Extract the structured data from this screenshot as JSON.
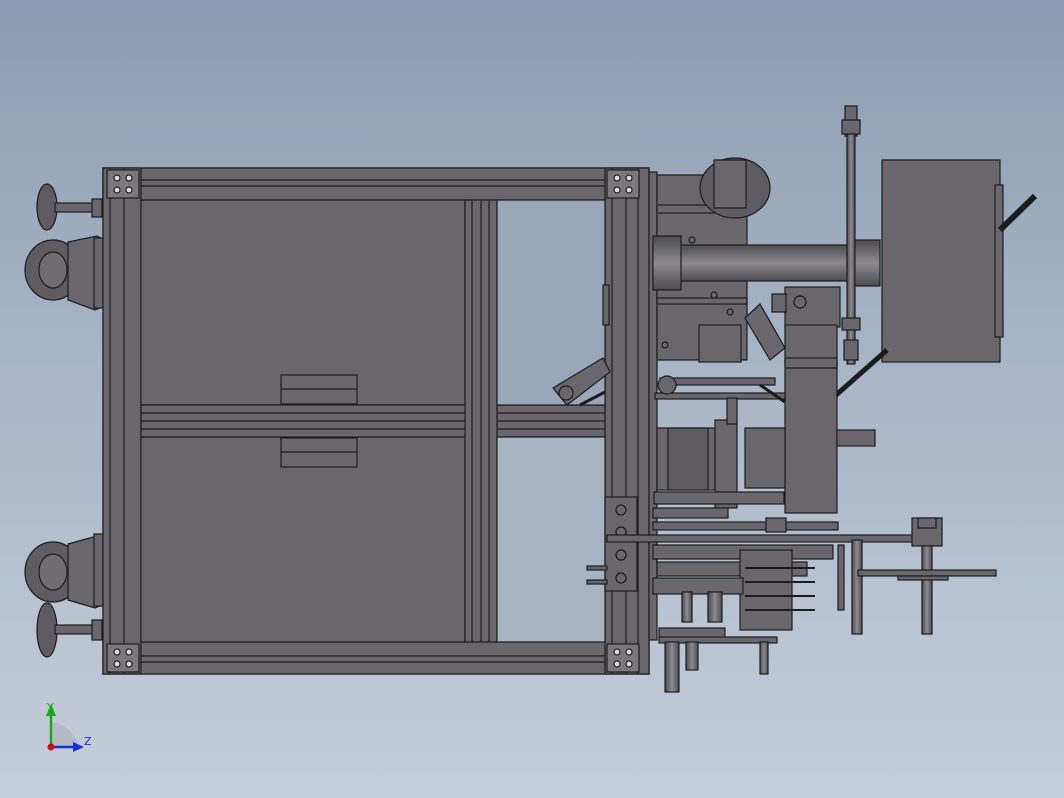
{
  "viewport": {
    "background_top": "#8c9cb1",
    "background_bottom": "#c6ced9"
  },
  "model": {
    "body_color": "#69676b",
    "edge_color": "#1c1c1e",
    "highlight_color": "#8a888c"
  },
  "triad": {
    "y_label": "Y",
    "z_label": "Z",
    "y_color": "#1aa51a",
    "z_color": "#1b2fd6",
    "origin_color": "#d01010"
  }
}
